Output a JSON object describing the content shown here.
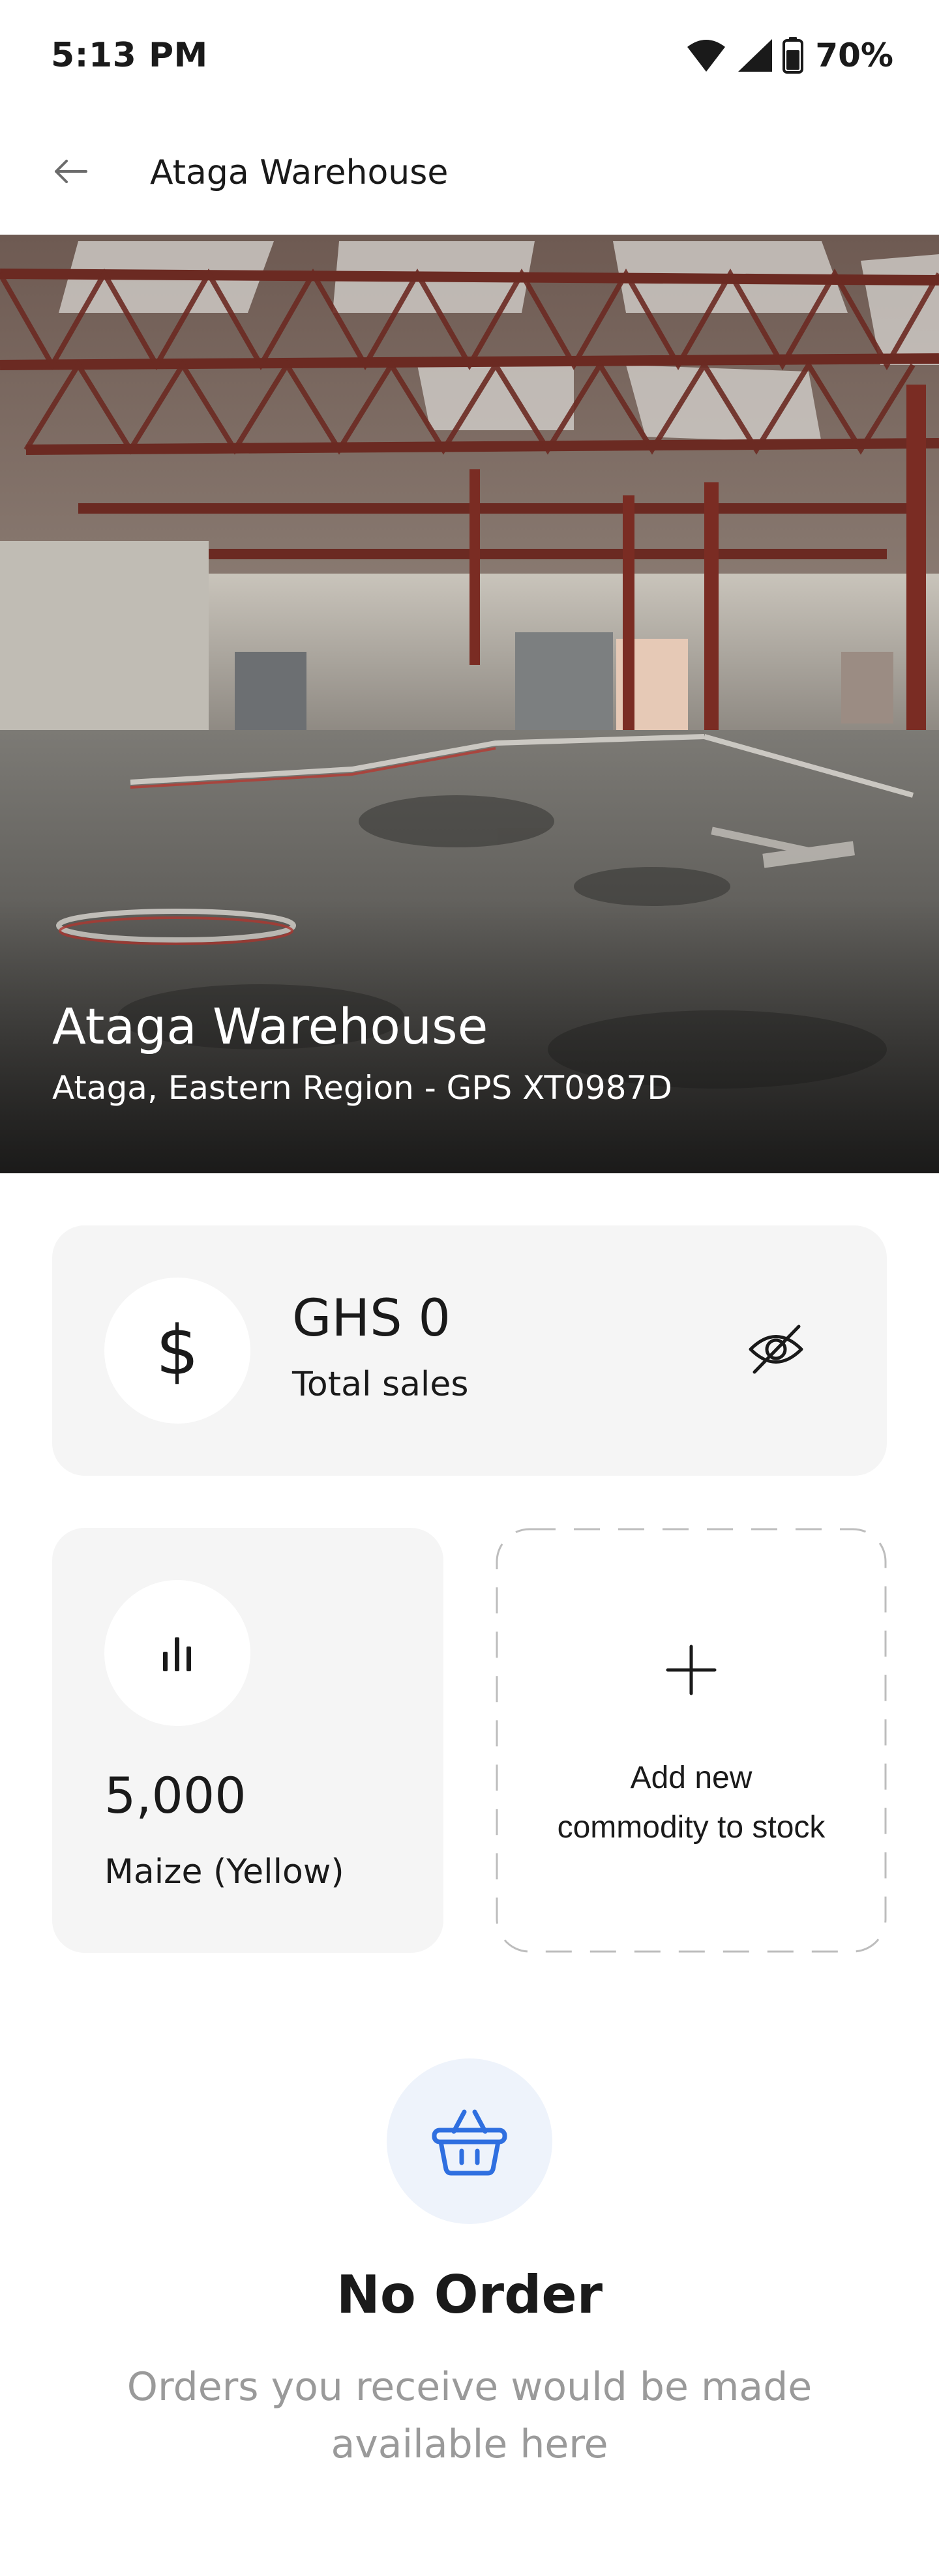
{
  "status_bar": {
    "time": "5:13 PM",
    "battery_percent": "70%",
    "icons": [
      "wifi-icon",
      "cellular-signal-icon",
      "battery-icon"
    ]
  },
  "app_bar": {
    "title": "Ataga Warehouse",
    "back_icon": "arrow-left-icon"
  },
  "hero": {
    "title": "Ataga Warehouse",
    "subtitle": "Ataga, Eastern Region - GPS XT0987D"
  },
  "sales_card": {
    "icon": "dollar-icon",
    "icon_glyph": "$",
    "amount": "GHS 0",
    "label": "Total sales",
    "toggle_icon": "eye-off-icon"
  },
  "commodity_card": {
    "icon": "bar-chart-icon",
    "quantity": "5,000",
    "name": "Maize (Yellow)"
  },
  "add_card": {
    "icon": "plus-icon",
    "line1": "Add new",
    "line2": "commodity to stock"
  },
  "orders_empty": {
    "icon": "basket-icon",
    "title": "No Order",
    "message": "Orders you receive would be made available here"
  },
  "colors": {
    "card_background": "#f5f5f5",
    "basket_accent": "#2f6fe0",
    "basket_circle": "#eef3fb",
    "muted_text": "#9a9a9a"
  }
}
